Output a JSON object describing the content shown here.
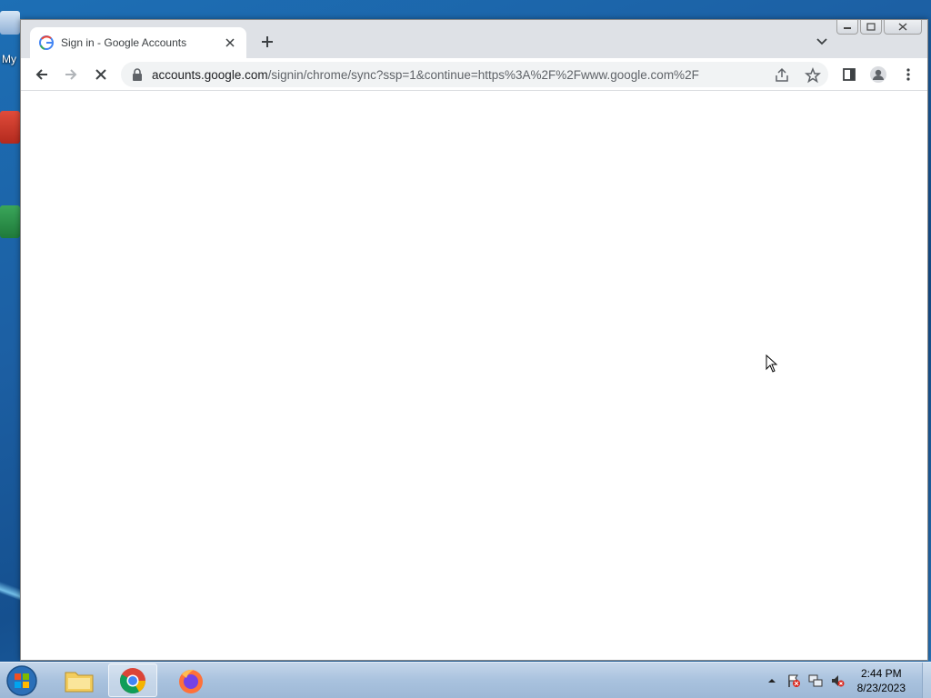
{
  "desktop": {
    "icon_label_partial": "My"
  },
  "browser": {
    "tab": {
      "title": "Sign in - Google Accounts",
      "favicon": "google-g-icon"
    },
    "new_tab_icon": "plus-icon",
    "tab_search_icon": "chevron-down-icon",
    "window_controls": [
      "minimize",
      "restore",
      "close"
    ],
    "toolbar": {
      "back_icon": "arrow-left-icon",
      "forward_icon": "arrow-right-icon",
      "reload_icon": "stop-loading-icon"
    },
    "omnibox": {
      "host": "accounts.google.com",
      "path": "/signin/chrome/sync?ssp=1&continue=https%3A%2F%2Fwww.google.com%2F",
      "icons": [
        "share-icon",
        "bookmark-star-icon"
      ]
    },
    "toolbar_right_icons": [
      "side-panel-icon",
      "profile-icon",
      "menu-icon"
    ]
  },
  "taskbar": {
    "apps": [
      "start-orb",
      "file-explorer",
      "chrome",
      "firefox"
    ],
    "active_app": "chrome",
    "clock": {
      "time": "2:44 PM",
      "date": "8/23/2023"
    },
    "tray_icons": [
      "show-hidden-icons",
      "action-center-flag-icon",
      "network-icon",
      "volume-muted-icon"
    ]
  },
  "colors": {
    "tab_strip": "#dee1e6",
    "omnibox_bg": "#f1f3f4",
    "desktop_bg": "#1d6fb5"
  }
}
